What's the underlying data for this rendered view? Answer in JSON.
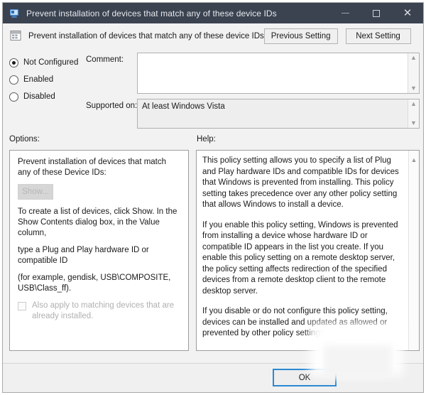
{
  "window": {
    "title": "Prevent installation of devices that match any of these device IDs",
    "title_icon": "policy-monitor-icon",
    "controls": {
      "minimize": "minimize-icon",
      "maximize": "maximize-icon",
      "close": "close-icon"
    }
  },
  "header": {
    "icon": "group-policy-setting-icon",
    "title": "Prevent installation of devices that match any of these device IDs",
    "previous_setting": "Previous Setting",
    "next_setting": "Next Setting"
  },
  "state": {
    "options": [
      {
        "label": "Not Configured",
        "selected": true
      },
      {
        "label": "Enabled",
        "selected": false
      },
      {
        "label": "Disabled",
        "selected": false
      }
    ]
  },
  "comment": {
    "label": "Comment:",
    "value": "",
    "placeholder": ""
  },
  "supported_on": {
    "label": "Supported on:",
    "value": "At least Windows Vista"
  },
  "options_panel": {
    "label": "Options:",
    "heading": "Prevent installation of devices that match any of these Device IDs:",
    "show_button": "Show...",
    "show_button_enabled": false,
    "paragraphs": [
      "To create a list of devices, click Show. In the Show Contents dialog box, in the Value column,",
      "type a Plug and Play hardware ID or compatible ID",
      "(for example, gendisk, USB\\COMPOSITE, USB\\Class_ff)."
    ],
    "checkbox": {
      "label": "Also apply to matching devices that are already installed.",
      "checked": false,
      "enabled": false
    }
  },
  "help_panel": {
    "label": "Help:",
    "paragraphs": [
      "This policy setting allows you to specify a list of Plug and Play hardware IDs and compatible IDs for devices that Windows is prevented from installing. This policy setting takes precedence over any other policy setting that allows Windows to install a device.",
      "If you enable this policy setting, Windows is prevented from installing a device whose hardware ID or compatible ID appears in the list you create. If you enable this policy setting on a remote desktop server, the policy setting affects redirection of the specified devices from a remote desktop client to the remote desktop server.",
      "If you disable or do not configure this policy setting, devices can be installed and updated as allowed or prevented by other policy settings."
    ],
    "scroll_up": "scroll-up-arrow"
  },
  "footer": {
    "ok": "OK"
  },
  "colors": {
    "titlebar": "#3b4351",
    "dialog_bg": "#f2f2f2",
    "accent_focus": "#2a8ad4",
    "panel_bg": "#ffffff"
  }
}
